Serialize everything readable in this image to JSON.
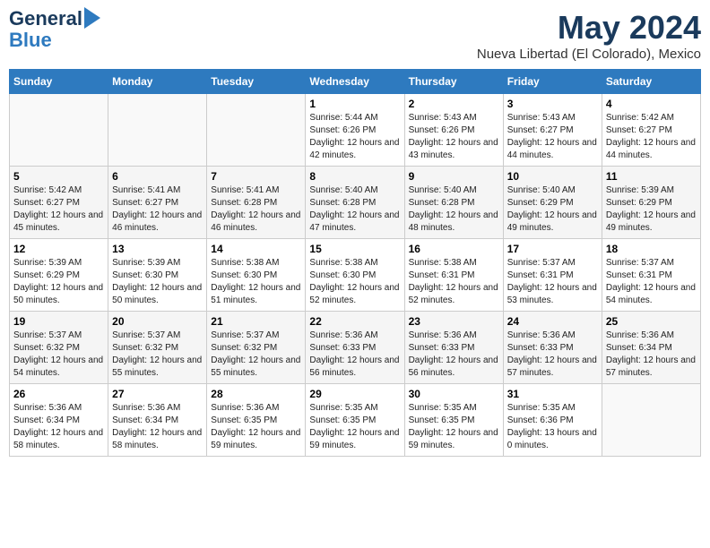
{
  "header": {
    "logo_line1": "General",
    "logo_line2": "Blue",
    "month_year": "May 2024",
    "location": "Nueva Libertad (El Colorado), Mexico"
  },
  "days_of_week": [
    "Sunday",
    "Monday",
    "Tuesday",
    "Wednesday",
    "Thursday",
    "Friday",
    "Saturday"
  ],
  "weeks": [
    [
      {
        "num": "",
        "detail": ""
      },
      {
        "num": "",
        "detail": ""
      },
      {
        "num": "",
        "detail": ""
      },
      {
        "num": "1",
        "detail": "Sunrise: 5:44 AM\nSunset: 6:26 PM\nDaylight: 12 hours\nand 42 minutes."
      },
      {
        "num": "2",
        "detail": "Sunrise: 5:43 AM\nSunset: 6:26 PM\nDaylight: 12 hours\nand 43 minutes."
      },
      {
        "num": "3",
        "detail": "Sunrise: 5:43 AM\nSunset: 6:27 PM\nDaylight: 12 hours\nand 44 minutes."
      },
      {
        "num": "4",
        "detail": "Sunrise: 5:42 AM\nSunset: 6:27 PM\nDaylight: 12 hours\nand 44 minutes."
      }
    ],
    [
      {
        "num": "5",
        "detail": "Sunrise: 5:42 AM\nSunset: 6:27 PM\nDaylight: 12 hours\nand 45 minutes."
      },
      {
        "num": "6",
        "detail": "Sunrise: 5:41 AM\nSunset: 6:27 PM\nDaylight: 12 hours\nand 46 minutes."
      },
      {
        "num": "7",
        "detail": "Sunrise: 5:41 AM\nSunset: 6:28 PM\nDaylight: 12 hours\nand 46 minutes."
      },
      {
        "num": "8",
        "detail": "Sunrise: 5:40 AM\nSunset: 6:28 PM\nDaylight: 12 hours\nand 47 minutes."
      },
      {
        "num": "9",
        "detail": "Sunrise: 5:40 AM\nSunset: 6:28 PM\nDaylight: 12 hours\nand 48 minutes."
      },
      {
        "num": "10",
        "detail": "Sunrise: 5:40 AM\nSunset: 6:29 PM\nDaylight: 12 hours\nand 49 minutes."
      },
      {
        "num": "11",
        "detail": "Sunrise: 5:39 AM\nSunset: 6:29 PM\nDaylight: 12 hours\nand 49 minutes."
      }
    ],
    [
      {
        "num": "12",
        "detail": "Sunrise: 5:39 AM\nSunset: 6:29 PM\nDaylight: 12 hours\nand 50 minutes."
      },
      {
        "num": "13",
        "detail": "Sunrise: 5:39 AM\nSunset: 6:30 PM\nDaylight: 12 hours\nand 50 minutes."
      },
      {
        "num": "14",
        "detail": "Sunrise: 5:38 AM\nSunset: 6:30 PM\nDaylight: 12 hours\nand 51 minutes."
      },
      {
        "num": "15",
        "detail": "Sunrise: 5:38 AM\nSunset: 6:30 PM\nDaylight: 12 hours\nand 52 minutes."
      },
      {
        "num": "16",
        "detail": "Sunrise: 5:38 AM\nSunset: 6:31 PM\nDaylight: 12 hours\nand 52 minutes."
      },
      {
        "num": "17",
        "detail": "Sunrise: 5:37 AM\nSunset: 6:31 PM\nDaylight: 12 hours\nand 53 minutes."
      },
      {
        "num": "18",
        "detail": "Sunrise: 5:37 AM\nSunset: 6:31 PM\nDaylight: 12 hours\nand 54 minutes."
      }
    ],
    [
      {
        "num": "19",
        "detail": "Sunrise: 5:37 AM\nSunset: 6:32 PM\nDaylight: 12 hours\nand 54 minutes."
      },
      {
        "num": "20",
        "detail": "Sunrise: 5:37 AM\nSunset: 6:32 PM\nDaylight: 12 hours\nand 55 minutes."
      },
      {
        "num": "21",
        "detail": "Sunrise: 5:37 AM\nSunset: 6:32 PM\nDaylight: 12 hours\nand 55 minutes."
      },
      {
        "num": "22",
        "detail": "Sunrise: 5:36 AM\nSunset: 6:33 PM\nDaylight: 12 hours\nand 56 minutes."
      },
      {
        "num": "23",
        "detail": "Sunrise: 5:36 AM\nSunset: 6:33 PM\nDaylight: 12 hours\nand 56 minutes."
      },
      {
        "num": "24",
        "detail": "Sunrise: 5:36 AM\nSunset: 6:33 PM\nDaylight: 12 hours\nand 57 minutes."
      },
      {
        "num": "25",
        "detail": "Sunrise: 5:36 AM\nSunset: 6:34 PM\nDaylight: 12 hours\nand 57 minutes."
      }
    ],
    [
      {
        "num": "26",
        "detail": "Sunrise: 5:36 AM\nSunset: 6:34 PM\nDaylight: 12 hours\nand 58 minutes."
      },
      {
        "num": "27",
        "detail": "Sunrise: 5:36 AM\nSunset: 6:34 PM\nDaylight: 12 hours\nand 58 minutes."
      },
      {
        "num": "28",
        "detail": "Sunrise: 5:36 AM\nSunset: 6:35 PM\nDaylight: 12 hours\nand 59 minutes."
      },
      {
        "num": "29",
        "detail": "Sunrise: 5:35 AM\nSunset: 6:35 PM\nDaylight: 12 hours\nand 59 minutes."
      },
      {
        "num": "30",
        "detail": "Sunrise: 5:35 AM\nSunset: 6:35 PM\nDaylight: 12 hours\nand 59 minutes."
      },
      {
        "num": "31",
        "detail": "Sunrise: 5:35 AM\nSunset: 6:36 PM\nDaylight: 13 hours\nand 0 minutes."
      },
      {
        "num": "",
        "detail": ""
      }
    ]
  ]
}
